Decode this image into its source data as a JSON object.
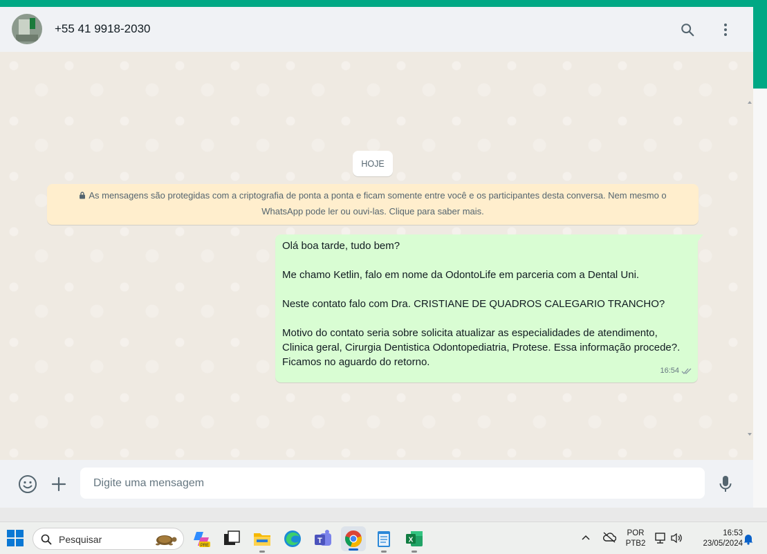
{
  "colors": {
    "accent": "#00a884",
    "header_bg": "#f0f2f5",
    "chat_bg": "#efeae2",
    "outgoing_bubble": "#d9fdd3",
    "system_notice_bg": "#ffeecd"
  },
  "header": {
    "contact_name": "+55 41 9918-2030",
    "icons": [
      "search-icon",
      "menu-kebab-icon"
    ]
  },
  "chat": {
    "date_divider": "HOJE",
    "encryption_notice": "As mensagens são protegidas com a criptografia de ponta a ponta e ficam somente entre você e os participantes desta conversa. Nem mesmo o WhatsApp pode ler ou ouvi-las. Clique para saber mais.",
    "messages": [
      {
        "direction": "outgoing",
        "paragraphs": [
          "Olá boa tarde, tudo bem?",
          "Me chamo Ketlin, falo em nome da OdontoLife em parceria com a Dental Uni.",
          "Neste contato falo com Dra. CRISTIANE DE QUADROS CALEGARIO TRANCHO?",
          "Motivo do contato seria sobre solicita atualizar as especialidades de atendimento,",
          "Clinica geral, Cirurgia Dentistica Odontopediatria, Protese. Essa informação procede?.",
          "Ficamos no aguardo do retorno."
        ],
        "time": "16:54",
        "status": "delivered"
      }
    ]
  },
  "composer": {
    "placeholder": "Digite uma mensagem",
    "icons": [
      "emoji-icon",
      "attach-plus-icon",
      "microphone-icon"
    ]
  },
  "taskbar": {
    "search_placeholder": "Pesquisar",
    "apps": [
      "windows-start-icon",
      "copilot-icon",
      "task-view-icon",
      "file-explorer-icon",
      "edge-icon",
      "teams-icon",
      "chrome-icon",
      "notepad-icon",
      "excel-icon"
    ],
    "tray": {
      "language": "POR",
      "layout": "PTB2",
      "time": "16:53",
      "date": "23/05/2024"
    }
  }
}
